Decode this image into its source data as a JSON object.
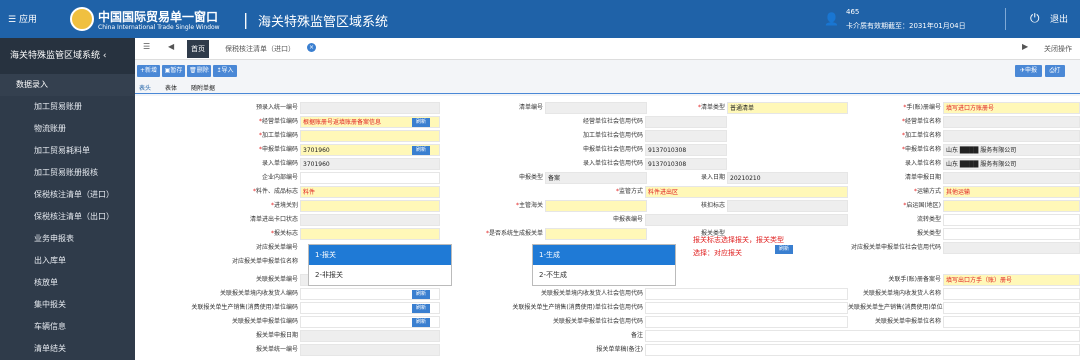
{
  "header": {
    "menu_label": "应用",
    "title_cn": "中国国际贸易单一窗口",
    "title_en": "China International Trade Single Window",
    "system": "海关特殊监管区域系统",
    "user_id": "465",
    "cert": "卡介质有效期截至：2031年01月04日",
    "exit_label": "退出"
  },
  "sidebar": {
    "title": "海关特殊监管区域系统",
    "category": "数据录入",
    "items": [
      "加工贸易账册",
      "物流账册",
      "加工贸易耗料单",
      "加工贸易账册报核",
      "保税核注清单（进口）",
      "保税核注清单（出口）",
      "业务申报表",
      "出入库单",
      "核放单",
      "集中报关",
      "车辆信息",
      "清单结关"
    ]
  },
  "tabs": {
    "home": "首页",
    "active": "保税核注清单（进口）",
    "close_others": "关闭操作"
  },
  "toolbar": {
    "add": "新增",
    "save": "暂存",
    "delete": "删除",
    "import": "导入",
    "declare": "申报",
    "print": "打"
  },
  "subtabs": [
    "表头",
    "表体",
    "随附单据"
  ],
  "form": {
    "r1": {
      "l1": "预录入统一编号",
      "l2": "清单编号",
      "l3": "清单类型",
      "v3": "普通清单",
      "l4": "手(账)册编号",
      "v4": "填写进口方账册号"
    },
    "r2": {
      "l1": "经营单位编码",
      "v1": "根据账册号返填账册备案信息",
      "l2": "经营单位社会信用代码",
      "l4": "经营单位名称"
    },
    "r3": {
      "l1": "加工单位编码",
      "l2": "加工单位社会信用代码",
      "l4": "加工单位名称"
    },
    "r4": {
      "l1": "申报单位编码",
      "v1": "3701960",
      "l2": "申报单位社会信用代码",
      "v2": "9137010308",
      "l4": "申报单位名称",
      "v4": "山东",
      "v4b": "服务有限公司"
    },
    "r5": {
      "l1": "录入单位编码",
      "v1": "3701960",
      "l2": "录入单位社会信用代码",
      "v2": "9137010308",
      "l4": "录入单位名称",
      "v4": "山东",
      "v4b": "服务有限公司"
    },
    "r6": {
      "l1": "企业内部编号",
      "l2": "申报类型",
      "v2": "备案",
      "l3": "录入日期",
      "v3": "20210210",
      "l4": "清单申报日期"
    },
    "r7": {
      "l1": "料件、成品标志",
      "v1": "料件",
      "l2": "监管方式",
      "v2": "料件进出区",
      "l4": "运输方式",
      "v4": "其他运输"
    },
    "r8": {
      "l1": "进境关别",
      "l2": "主管海关",
      "l3": "核扣标志",
      "l4": "启运国(地区)"
    },
    "r9": {
      "l1": "清单进出卡口状态",
      "l3": "申报表编号",
      "l4": "流转类型"
    },
    "r10": {
      "l1": "报关标志",
      "l2": "是否系统生成报关单",
      "l3": "报关类型",
      "l4": "报关类型"
    },
    "r11": {
      "l1": "对应报关单编号",
      "l4": "对应报关单申报单位社会信用代码"
    },
    "r12": {
      "l1": "对应报关单申报单位名称"
    },
    "r13": {
      "l1": "关联报关单编号",
      "l4": "关联手(账)册备案号",
      "v4": "填写出口方手（账）册号"
    },
    "r14": {
      "l1": "关联报关单境内收发货人编码",
      "l2": "关联报关单境内收发货人社会信用代码",
      "l4": "关联报关单境内收发货人名称"
    },
    "r15": {
      "l1": "关联报关单生产销售(消费使用)单位编码",
      "l2": "关联报关单生产销售(消费使用)单位社会信用代码",
      "l4": "关联报关单生产销售(消费使用)单位名称"
    },
    "r16": {
      "l1": "关联报关单申报单位编码",
      "l2": "关联报关单申报单位社会信用代码",
      "l4": "关联报关单申报单位名称"
    },
    "r17": {
      "l1": "报关单申报日期",
      "l3": "备注"
    },
    "r18": {
      "l1": "报关单统一编号",
      "l3": "报关单草稿(备注)"
    },
    "refresh": "刷新"
  },
  "dropdown_flag": [
    "1-报关",
    "2-非报关"
  ],
  "dropdown_gen": [
    "1-生成",
    "2-不生成"
  ],
  "note": "报关标志选择报关，报关类型选择：对应报关"
}
